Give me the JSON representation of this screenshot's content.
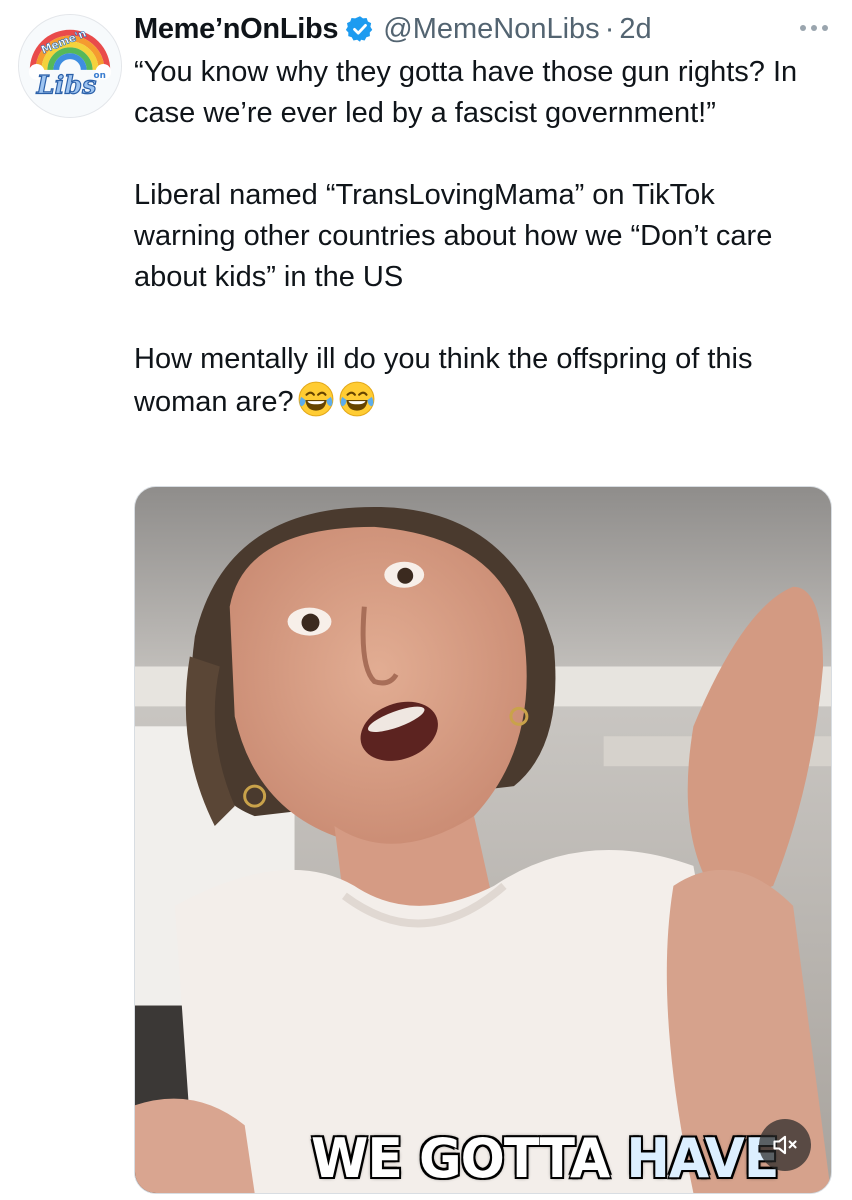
{
  "tweet": {
    "display_name": "Meme’nOnLibs",
    "handle": "@MemeNonLibs",
    "separator": "·",
    "time": "2d",
    "paragraphs": [
      "“You know why they gotta have those gun rights? In case we’re ever led by a fascist government!”",
      "Liberal named “TransLovingMama” on TikTok warning other countries about how we “Don’t care about kids” in the US",
      "How mentally ill do you think the offspring of this woman are?"
    ],
    "emoji": [
      "face-with-tears-of-joy",
      "face-with-tears-of-joy"
    ],
    "avatar": {
      "top_text": "Meme'n",
      "small_text": "on",
      "main_text": "Libs"
    }
  },
  "media": {
    "type": "video",
    "caption_words": [
      "WE",
      "GOTTA",
      "HAVE"
    ],
    "mute_icon": "speaker-muted-icon"
  },
  "icons": {
    "verified": "verified-badge-icon",
    "more": "more-options-icon"
  },
  "colors": {
    "text": "#0f1419",
    "secondary": "#536471",
    "verified_blue": "#1d9bf0"
  }
}
